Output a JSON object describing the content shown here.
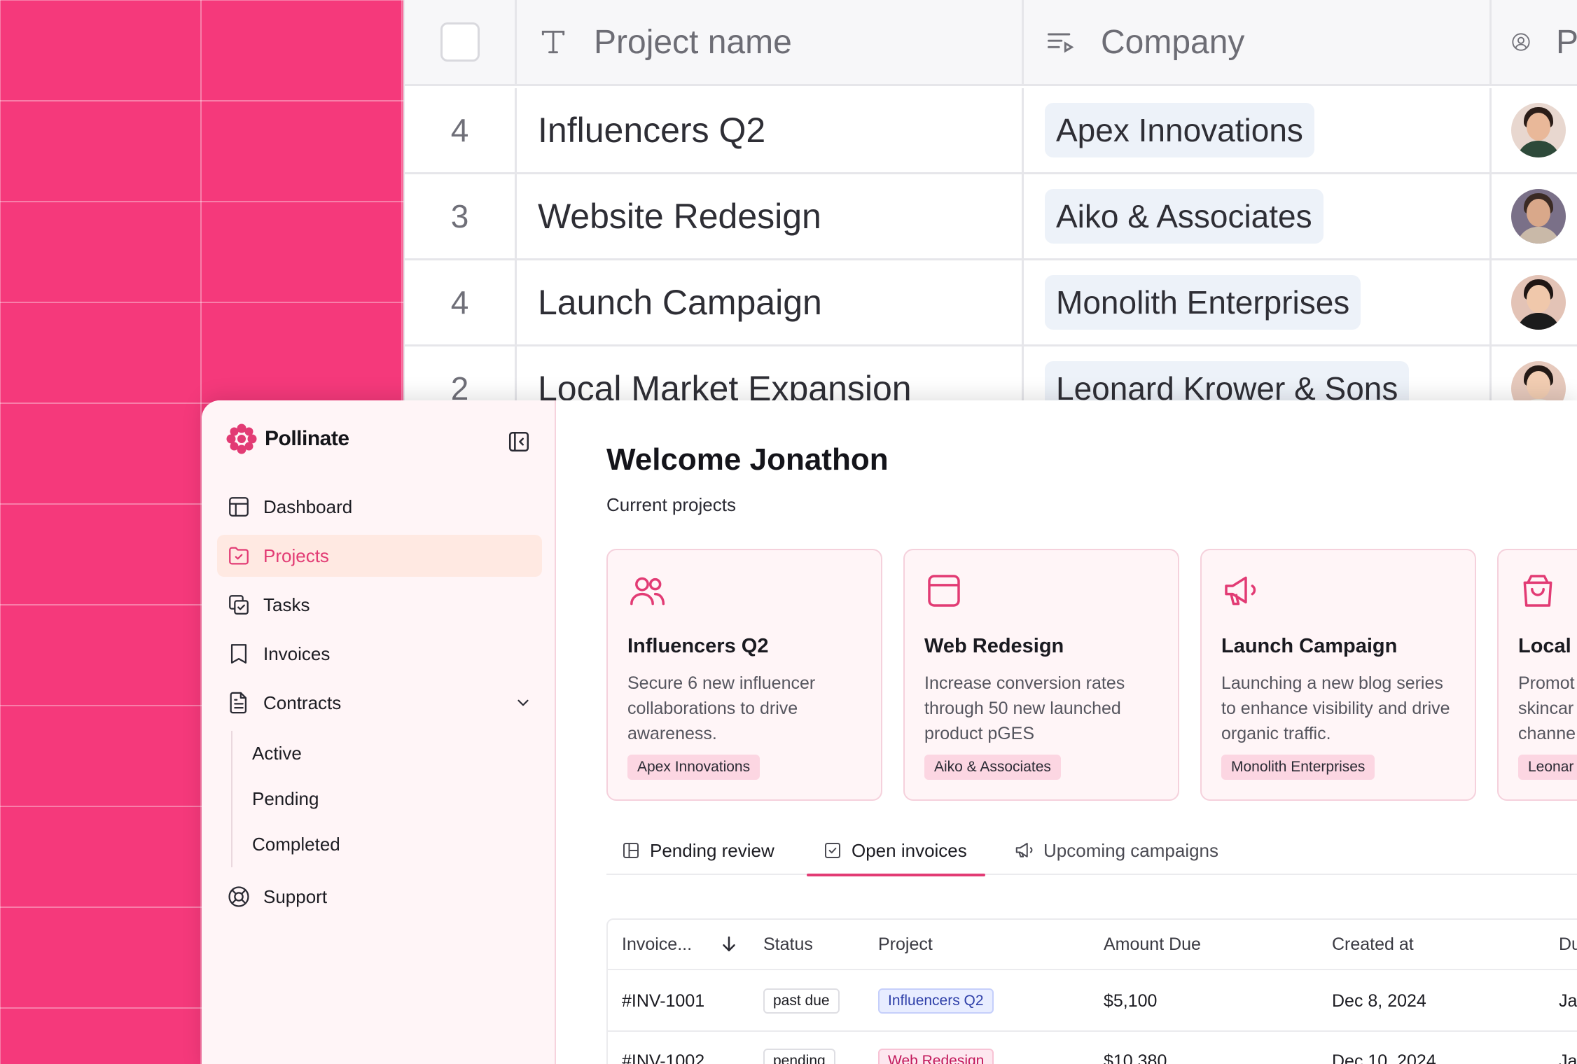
{
  "back_table": {
    "headers": {
      "name": "Project name",
      "company": "Company",
      "person": "P"
    },
    "rows": [
      {
        "num": "4",
        "name": "Influencers Q2",
        "company": "Apex Innovations"
      },
      {
        "num": "3",
        "name": "Website Redesign",
        "company": "Aiko & Associates"
      },
      {
        "num": "4",
        "name": "Launch Campaign",
        "company": "Monolith Enterprises"
      },
      {
        "num": "2",
        "name": "Local Market Expansion",
        "company": "Leonard Krower & Sons"
      }
    ]
  },
  "app": {
    "brand": "Pollinate",
    "sidebar": {
      "items": [
        {
          "label": "Dashboard",
          "icon": "layout-icon"
        },
        {
          "label": "Projects",
          "icon": "folder-check-icon",
          "active": true
        },
        {
          "label": "Tasks",
          "icon": "tasks-icon"
        },
        {
          "label": "Invoices",
          "icon": "receipt-icon"
        },
        {
          "label": "Contracts",
          "icon": "document-icon",
          "expanded": true
        }
      ],
      "contracts_sub": [
        "Active",
        "Pending",
        "Completed"
      ],
      "support": "Support"
    },
    "main": {
      "welcome": "Welcome Jonathon",
      "subheading": "Current projects",
      "cards": [
        {
          "title": "Influencers Q2",
          "desc": "Secure 6 new influencer collaborations to drive awareness.",
          "tag": "Apex Innovations",
          "icon": "users-icon"
        },
        {
          "title": "Web Redesign",
          "desc": "Increase conversion rates through 50 new launched product pGES",
          "tag": "Aiko & Associates",
          "icon": "browser-icon"
        },
        {
          "title": "Launch Campaign",
          "desc": "Launching a new blog series to enhance visibility and drive organic traffic.",
          "tag": "Monolith Enterprises",
          "icon": "megaphone-icon"
        },
        {
          "title": "Local I",
          "desc": "Promot skincar channe",
          "tag": "Leonar",
          "icon": "shopping-bag-icon"
        }
      ],
      "tabs": [
        {
          "label": "Pending review",
          "icon": "layout-icon"
        },
        {
          "label": "Open invoices",
          "icon": "checkbox-icon",
          "active": true
        },
        {
          "label": "Upcoming campaigns",
          "icon": "megaphone-icon"
        }
      ],
      "invoice_table": {
        "headers": [
          "Invoice...",
          "Status",
          "Project",
          "Amount Due",
          "Created at",
          "Du"
        ],
        "rows": [
          {
            "id": "#INV-1001",
            "status": "past due",
            "project": "Influencers Q2",
            "amount": "$5,100",
            "created": "Dec 8, 2024",
            "due": "Ja"
          },
          {
            "id": "#INV-1002",
            "status": "pending",
            "project": "Web Redesign",
            "amount": "$10,380",
            "created": "Dec 10, 2024",
            "due": "Ja"
          }
        ]
      }
    }
  },
  "colors": {
    "accent": "#e23b74",
    "background": "#f5397b",
    "sidebar": "#fff5f7"
  }
}
